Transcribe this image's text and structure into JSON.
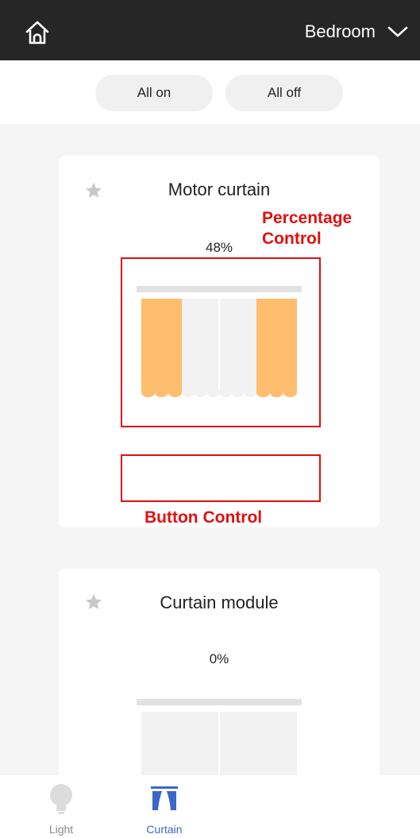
{
  "header": {
    "room": "Bedroom"
  },
  "quick_actions": {
    "all_on": "All on",
    "all_off": "All off"
  },
  "devices": [
    {
      "title": "Motor curtain",
      "percent": "48%",
      "level": 0.48
    },
    {
      "title": "Curtain module",
      "percent": "0%",
      "level": 0.0
    }
  ],
  "annotations": {
    "percentage_line1": "Percentage",
    "percentage_line2": "Control",
    "button_control": "Button Control"
  },
  "tabs": [
    {
      "label": "Light"
    },
    {
      "label": "Curtain"
    }
  ],
  "colors": {
    "accent": "#3a67c9",
    "curtain_fill": "#ffbd6e",
    "annotation": "#e01010",
    "header_bg": "#262626"
  }
}
